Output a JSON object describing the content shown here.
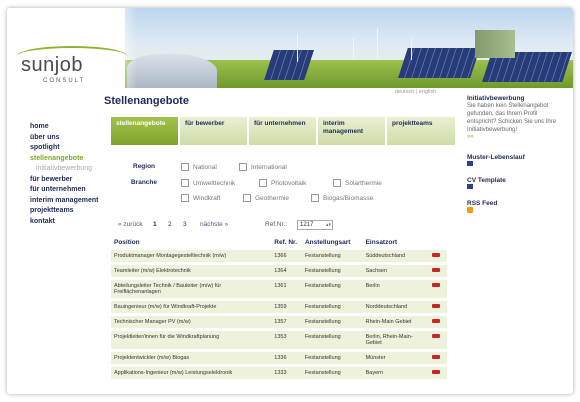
{
  "brand": {
    "name": "sunjob",
    "sub": "CONSULT"
  },
  "page_title": "Stellenangebote",
  "lang": {
    "de": "deutsch",
    "sep": "|",
    "en": "english"
  },
  "nav": {
    "items": [
      {
        "label": "home"
      },
      {
        "label": "über uns"
      },
      {
        "label": "spotlight"
      },
      {
        "label": "stellenangebote"
      },
      {
        "label": "initiativbewerbung"
      },
      {
        "label": "für bewerber"
      },
      {
        "label": "für unternehmen"
      },
      {
        "label": "interim management"
      },
      {
        "label": "projektteams"
      },
      {
        "label": "kontakt"
      }
    ]
  },
  "tabs": [
    {
      "label": "stellenangebote"
    },
    {
      "label": "für bewerber"
    },
    {
      "label": "für unternehmen"
    },
    {
      "label": "interim management"
    },
    {
      "label": "projektteams"
    }
  ],
  "filters": {
    "region_label": "Region",
    "branche_label": "Branche",
    "region": [
      "National",
      "International"
    ],
    "branche": [
      "Umwelttechnik",
      "Photovoltaik",
      "Solarthermie",
      "Windkraft",
      "Geothermie",
      "Biogas/Biomasse"
    ]
  },
  "pager": {
    "back": "« zurück",
    "pages": [
      "1",
      "2",
      "3"
    ],
    "next": "nächste »",
    "ref_label": "Ref.Nr.:",
    "ref_value": "1217"
  },
  "table": {
    "headers": {
      "position": "Position",
      "ref": "Ref. Nr.",
      "type": "Anstellungsart",
      "place": "Einsatzort"
    },
    "rows": [
      {
        "position": "Produktmanager Montagegestelltechnik (m/w)",
        "ref": "1366",
        "type": "Festanstellung",
        "place": "Süddeutschland"
      },
      {
        "position": "Teamleiter (m/w) Elektrotechnik",
        "ref": "1364",
        "type": "Festanstellung",
        "place": "Sachsen"
      },
      {
        "position": "Abteilungsleiter Technik / Bauleiter (m/w) für Freiflächenanlagen",
        "ref": "1361",
        "type": "Festanstellung",
        "place": "Berlin"
      },
      {
        "position": "Bauingenieur (m/w) für Windkraft-Projekte",
        "ref": "1359",
        "type": "Festanstellung",
        "place": "Norddeutschland"
      },
      {
        "position": "Technischer Manager PV (m/w)",
        "ref": "1357",
        "type": "Festanstellung",
        "place": "Rhein-Main Gebiet"
      },
      {
        "position": "Projektleiter/innen für die Windkraftplanung",
        "ref": "1353",
        "type": "Festanstellung",
        "place": "Berlin, Rhein-Main-Gebiet"
      },
      {
        "position": "Projektentwickler (m/w) Biogas",
        "ref": "1336",
        "type": "Festanstellung",
        "place": "Münster"
      },
      {
        "position": "Applikations-Ingenieur (m/w) Leistungselektronik",
        "ref": "1333",
        "type": "Festanstellung",
        "place": "Bayern"
      }
    ]
  },
  "right": {
    "initiativ_title": "Initiativbewerbung",
    "initiativ_text": "Sie haben kein Stellenangebot gefunden, das Ihrem Profil entspricht? Schicken Sie uns Ihre Initiativbewerbung!",
    "more": "»»",
    "muster_title": "Muster-Lebenslauf",
    "cv_title": "CV Template",
    "rss_title": "RSS Feed"
  },
  "colors": {
    "accent": "#8ab52a",
    "navy": "#1f2a55",
    "row": "#edf2dc"
  }
}
